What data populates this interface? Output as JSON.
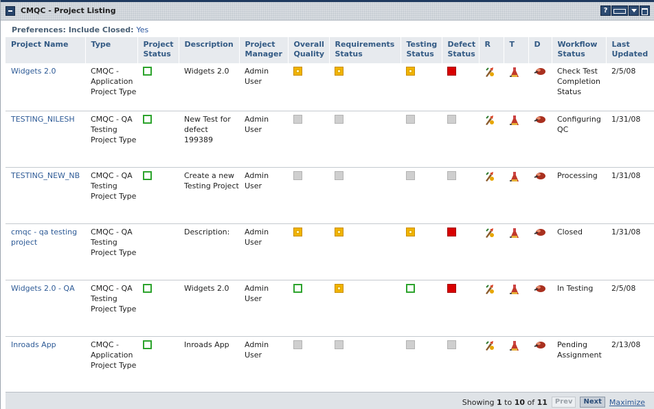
{
  "portlet": {
    "title": "CMQC - Project Listing",
    "help_icon": "?"
  },
  "preferences": {
    "label": "Preferences:",
    "include_closed_label": "Include Closed:",
    "include_closed_value": "Yes"
  },
  "columns": {
    "project_name": "Project Name",
    "type": "Type",
    "project_status": "Project Status",
    "description": "Description",
    "project_manager": "Project Manager",
    "overall_quality": "Overall Quality",
    "requirements_status": "Requirements Status",
    "testing_status": "Testing Status",
    "defect_status": "Defect Status",
    "r": "R",
    "t": "T",
    "d": "D",
    "workflow_status": "Workflow Status",
    "last_updated": "Last Updated"
  },
  "rows": [
    {
      "name": "Widgets 2.0",
      "type": "CMQC - Application Project Type",
      "project_status": "open",
      "description": "Widgets 2.0",
      "manager": "Admin User",
      "overall": "yellow",
      "requirements": "yellow",
      "testing": "yellow",
      "defect": "red",
      "workflow": "Check Test Completion Status",
      "updated": "2/5/08"
    },
    {
      "name": "TESTING_NILESH",
      "type": "CMQC - QA Testing Project Type",
      "project_status": "open",
      "description": "New Test for defect 199389",
      "manager": "Admin User",
      "overall": "gray",
      "requirements": "gray",
      "testing": "gray",
      "defect": "gray",
      "workflow": "Configuring QC",
      "updated": "1/31/08"
    },
    {
      "name": "TESTING_NEW_NB",
      "type": "CMQC - QA Testing Project Type",
      "project_status": "open",
      "description": "Create a new Testing Project",
      "manager": "Admin User",
      "overall": "gray",
      "requirements": "gray",
      "testing": "gray",
      "defect": "gray",
      "workflow": "Processing",
      "updated": "1/31/08"
    },
    {
      "name": "cmqc - qa testing project",
      "type": "CMQC - QA Testing Project Type",
      "project_status": "none",
      "description": "Description:",
      "manager": "Admin User",
      "overall": "yellow",
      "requirements": "yellow",
      "testing": "yellow",
      "defect": "red",
      "workflow": "Closed",
      "updated": "1/31/08"
    },
    {
      "name": "Widgets 2.0 - QA",
      "type": "CMQC - QA Testing Project Type",
      "project_status": "open",
      "description": "Widgets 2.0",
      "manager": "Admin User",
      "overall": "open",
      "requirements": "yellow",
      "testing": "open",
      "defect": "red",
      "workflow": "In Testing",
      "updated": "2/5/08"
    },
    {
      "name": "Inroads App",
      "type": "CMQC - Application Project Type",
      "project_status": "open",
      "description": "Inroads App",
      "manager": "Admin User",
      "overall": "gray",
      "requirements": "gray",
      "testing": "gray",
      "defect": "gray",
      "workflow": "Pending Assignment",
      "updated": "2/13/08"
    }
  ],
  "row_icons": {
    "r": "requirements-icon",
    "t": "testing-flask-icon",
    "d": "defect-bug-icon"
  },
  "pagination": {
    "showing_label": "Showing",
    "from": "1",
    "to_label": "to",
    "to": "10",
    "of_label": "of",
    "total": "11",
    "prev_label": "Prev",
    "next_label": "Next",
    "maximize_label": "Maximize"
  },
  "colors": {
    "link": "#2d5a96",
    "header_text": "#335a84",
    "status_green": "#2ca32c",
    "status_yellow": "#f0b400",
    "status_red": "#d80000",
    "status_gray": "#cfcfcf",
    "titlebar_accent": "#1f3a5f"
  }
}
